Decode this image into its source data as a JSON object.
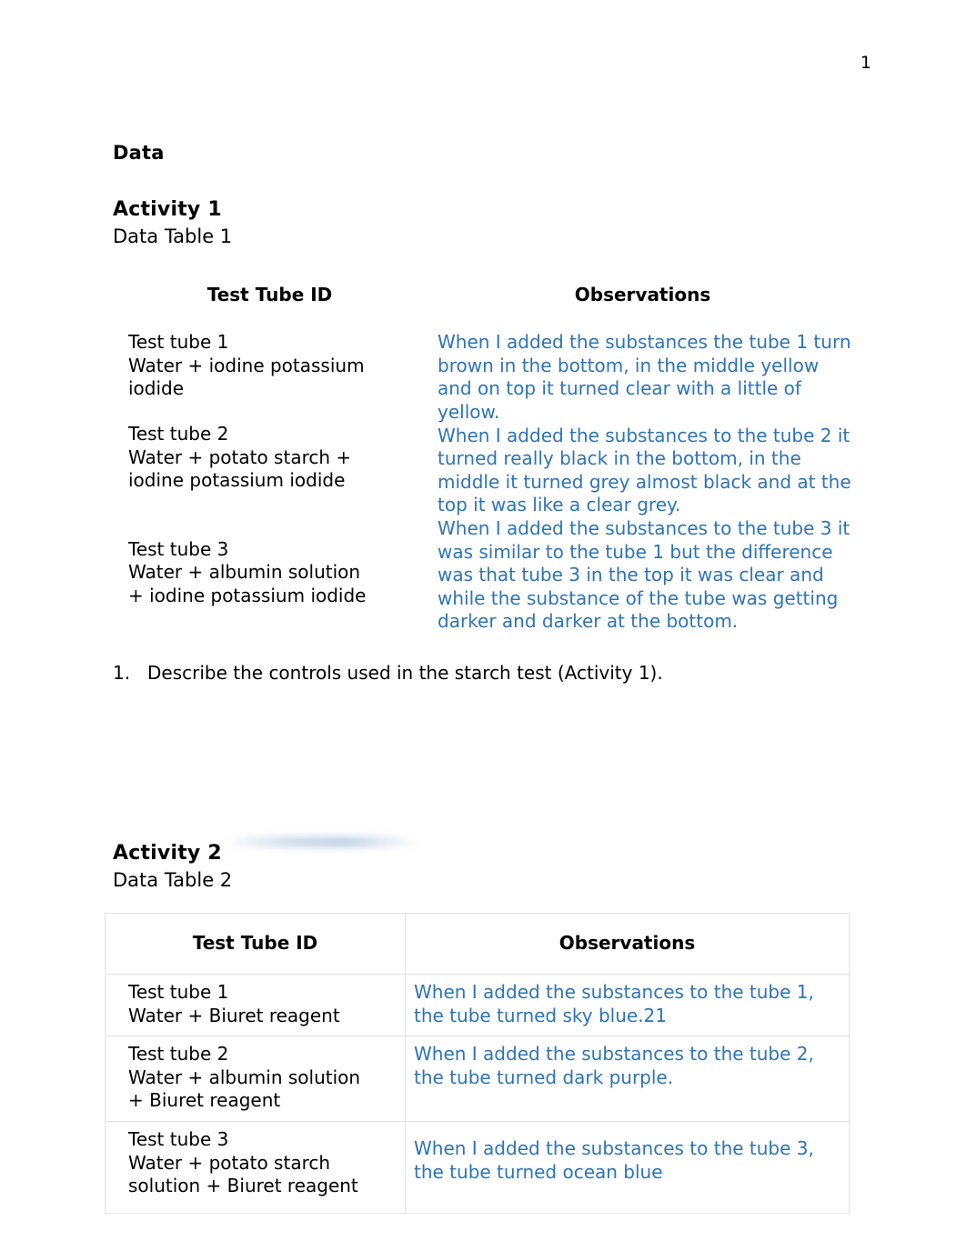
{
  "page": {
    "number": "1",
    "doc_heading": "Data"
  },
  "activity1": {
    "heading": "Activity 1",
    "subtitle": "Data Table 1",
    "table": {
      "headers": [
        "Test Tube ID",
        "Observations"
      ],
      "rows": [
        {
          "id_line1": "Test tube 1",
          "id_line2": "Water + iodine potassium",
          "id_line3": "iodide"
        },
        {
          "id_line1": "Test tube 2",
          "id_line2": "Water + potato starch +",
          "id_line3": "iodine potassium iodide"
        },
        {
          "id_line1": "Test tube 3",
          "id_line2": "Water + albumin solution",
          "id_line3": "+ iodine potassium iodide"
        }
      ],
      "observations": [
        "When I added the substances the tube 1 turn brown in the bottom, in the middle yellow and on top it turned clear with a little of yellow.",
        "When I added the substances to the tube 2 it turned really black in the bottom, in the middle it turned grey almost black and at the top it was like a clear grey.",
        "When I added the substances to the tube 3 it was similar to the tube 1 but the difference was that tube 3 in the top it was clear and while the substance of the tube was getting darker and darker at the bottom."
      ]
    }
  },
  "questions": [
    {
      "number": "1.",
      "text": "Describe the controls used in the starch test (Activity 1)."
    }
  ],
  "activity2": {
    "heading": "Activity 2",
    "subtitle": "Data Table 2",
    "table": {
      "headers": [
        "Test Tube ID",
        "Observations"
      ],
      "rows": [
        {
          "id_line1": "Test tube 1",
          "id_line2": "Water + Biuret reagent",
          "id_line3": "",
          "observation": "When I added the substances to the tube 1, the tube turned sky blue.21"
        },
        {
          "id_line1": "Test tube 2",
          "id_line2": "Water + albumin solution",
          "id_line3": "+ Biuret reagent",
          "observation": "When I added the substances to the tube 2, the tube turned dark purple."
        },
        {
          "id_line1": "Test tube 3",
          "id_line2": "Water + potato starch",
          "id_line3": "solution + Biuret reagent",
          "observation": "When I added the substances to the tube 3, the tube turned ocean blue"
        }
      ]
    }
  },
  "colors": {
    "observation_text": "#2e74b5",
    "body_text": "#000000",
    "table_border": "#e2e2e2",
    "page_background": "#ffffff"
  }
}
